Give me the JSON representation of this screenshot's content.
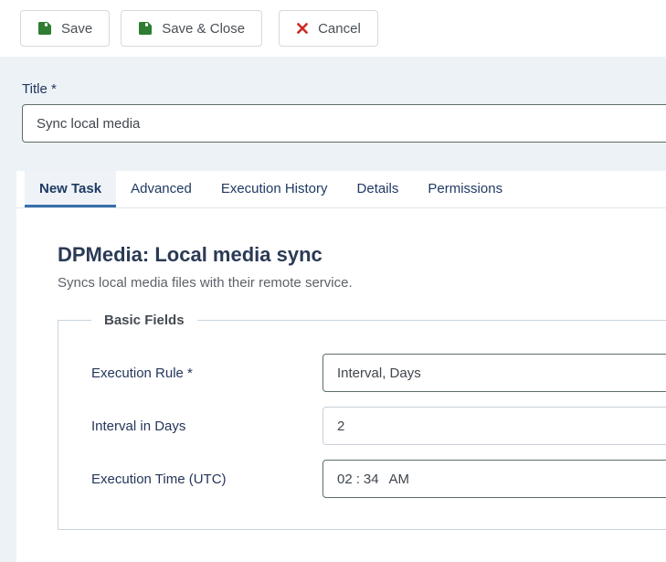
{
  "toolbar": {
    "save_label": "Save",
    "save_close_label": "Save & Close",
    "cancel_label": "Cancel"
  },
  "title_field": {
    "label": "Title *",
    "value": "Sync local media"
  },
  "tabs": [
    {
      "label": "New Task",
      "active": true
    },
    {
      "label": "Advanced",
      "active": false
    },
    {
      "label": "Execution History",
      "active": false
    },
    {
      "label": "Details",
      "active": false
    },
    {
      "label": "Permissions",
      "active": false
    }
  ],
  "content": {
    "heading": "DPMedia: Local media sync",
    "description": "Syncs local media files with their remote service.",
    "fieldset_legend": "Basic Fields",
    "fields": {
      "execution_rule": {
        "label": "Execution Rule *",
        "value": "Interval, Days"
      },
      "interval_days": {
        "label": "Interval in Days",
        "value": "2"
      },
      "execution_time": {
        "label": "Execution Time (UTC)",
        "hour": "02",
        "minute": "34",
        "separator": ":",
        "meridiem": "AM"
      }
    }
  },
  "icons": {
    "save": "floppy-disk",
    "cancel": "x-mark"
  },
  "colors": {
    "accent_tab_underline": "#376fac",
    "save_icon_green": "#2e7d32",
    "cancel_icon_red": "#cb2e25",
    "page_background": "#edf2f7",
    "label_navy": "#22365e",
    "input_border_dark": "#5b6e61",
    "input_border_light": "#c8d0d8"
  }
}
